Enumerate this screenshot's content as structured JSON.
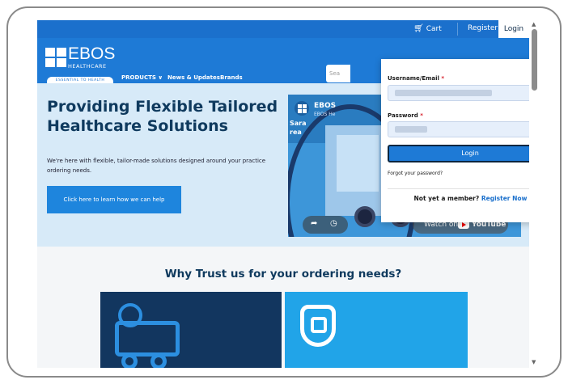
{
  "topbar": {
    "cart_label": "Cart",
    "cart_icon": "cart-icon",
    "register_label": "Register",
    "login_label": "Login"
  },
  "brand": {
    "logo_word": "EBOS",
    "logo_sub": "HEALTHCARE",
    "tagline": "ESSENTIAL TO HEALTH"
  },
  "nav": {
    "items": [
      "PRODUCTS ∨",
      "News & Updates",
      "Brands"
    ],
    "search_placeholder": "Sea"
  },
  "hero": {
    "title": "Providing Flexible Tailored Healthcare Solutions",
    "text": "We're here with flexible, tailor-made solutions designed around your practice ordering needs.",
    "button_label": "Click here to learn how we can help"
  },
  "video": {
    "channel_title": "EBOS",
    "channel_sub": "EBOS He",
    "side_text": "Sara\nrea",
    "watch_label": "Watch on",
    "youtube_label": "YouTube"
  },
  "trust": {
    "title": "Why Trust us for your ordering needs?"
  },
  "login_dropdown": {
    "username_label": "Username/Email",
    "password_label": "Password",
    "required_mark": "*",
    "button_label": "Login",
    "forgot_label": "Forgot your password?",
    "member_text": "Not yet a member?",
    "register_now": "Register Now"
  },
  "colors": {
    "brand_blue": "#1e7ad6",
    "dark_navy": "#12365f",
    "light_blue": "#21a4e8"
  }
}
